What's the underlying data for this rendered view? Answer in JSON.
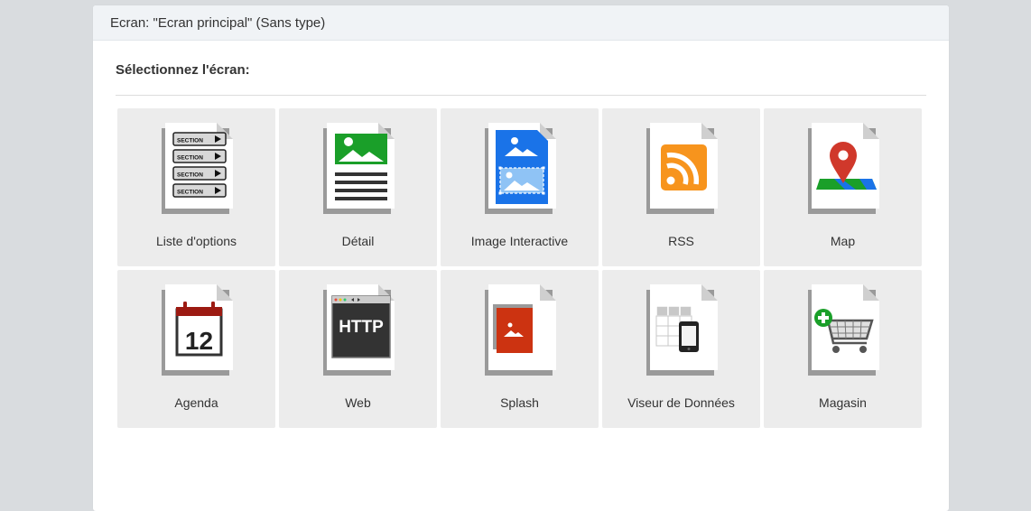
{
  "header": {
    "title": "Ecran: \"Ecran principal\" (Sans type)"
  },
  "main": {
    "section_title": "Sélectionnez l'écran:",
    "tiles": [
      {
        "label": "Liste d'options",
        "icon": "section-list-icon"
      },
      {
        "label": "Détail",
        "icon": "detail-icon"
      },
      {
        "label": "Image Interactive",
        "icon": "interactive-image-icon"
      },
      {
        "label": "RSS",
        "icon": "rss-icon"
      },
      {
        "label": "Map",
        "icon": "map-pin-icon"
      },
      {
        "label": "Agenda",
        "icon": "calendar-icon"
      },
      {
        "label": "Web",
        "icon": "http-browser-icon"
      },
      {
        "label": "Splash",
        "icon": "splash-image-icon"
      },
      {
        "label": "Viseur de Données",
        "icon": "data-viewer-icon"
      },
      {
        "label": "Magasin",
        "icon": "shopping-cart-icon"
      }
    ],
    "icon_texts": {
      "section": "SECTION",
      "calendar_day": "12",
      "http": "HTTP"
    }
  },
  "colors": {
    "page_bg": "#d9dcdf",
    "tile_bg": "#ececec",
    "header_bg": "#f0f3f6",
    "green": "#1a9f29",
    "blue": "#1a73e8",
    "rss_orange": "#f7941d",
    "map_red": "#d0382b",
    "calendar_red": "#9c1a12",
    "splash_red": "#cc3311"
  }
}
